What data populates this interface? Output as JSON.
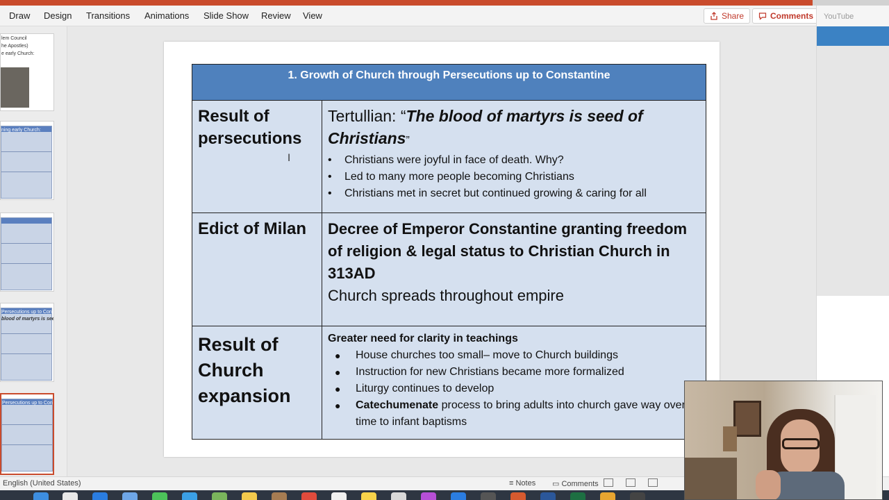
{
  "ribbon": {
    "tabs": [
      "Draw",
      "Design",
      "Transitions",
      "Animations",
      "Slide Show",
      "Review",
      "View"
    ],
    "share_label": "Share",
    "comments_label": "Comments"
  },
  "browser": {
    "tab_label": "YouTube"
  },
  "thumbnails": {
    "thumb1_lines": [
      "lem Council",
      "he Apostles)",
      "e early Church:"
    ],
    "thumb2_title": "ning early Church:",
    "thumb4_title": "Persecutions up to Constantine",
    "thumb4_quote": "blood of martyrs is seed of"
  },
  "slide": {
    "title": "1. Growth of Church through Persecutions up to Constantine",
    "row1": {
      "label": "Result of persecutions",
      "quote_prefix": "Tertullian: “",
      "quote_bold": "The blood of martyrs is seed of Christians",
      "quote_suffix": "”",
      "bullets": [
        "Christians were joyful in face of death. Why?",
        "Led to many more people becoming Christians",
        "Christians met in secret but continued growing & caring for all"
      ]
    },
    "row2": {
      "label": "Edict of Milan",
      "bold_text": "Decree of Emperor Constantine granting freedom of religion & legal status to Christian Church in 313AD",
      "plain_text": "Church spreads throughout empire"
    },
    "row3": {
      "label": "Result of Church expansion",
      "heading": "Greater need for clarity in teachings",
      "bullets": [
        "House churches  too small– move to Church buildings",
        "Instruction for new Christians became more formalized",
        "Liturgy continues to develop"
      ],
      "last_bullet_bold": "Catechumenate",
      "last_bullet_rest": " process to bring adults into church gave way over time to infant baptisms"
    }
  },
  "status": {
    "language": "English (United States)",
    "notes_label": "Notes",
    "comments_label": "Comments"
  },
  "colors": {
    "accent": "#c94b2c",
    "table_header": "#4f81bd",
    "table_cell": "#d5e0ef"
  }
}
